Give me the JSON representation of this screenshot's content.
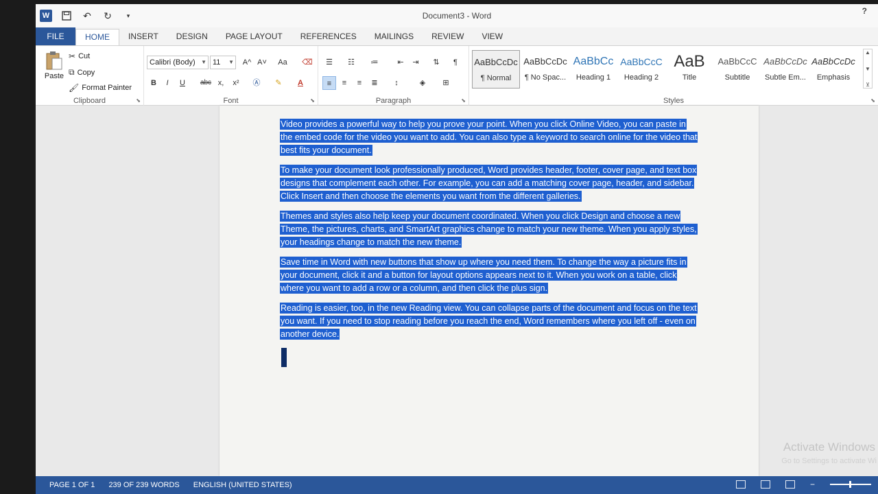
{
  "window": {
    "title": "Document3 - Word",
    "help": "?"
  },
  "tabs": [
    "FILE",
    "HOME",
    "INSERT",
    "DESIGN",
    "PAGE LAYOUT",
    "REFERENCES",
    "MAILINGS",
    "REVIEW",
    "VIEW"
  ],
  "clipboard": {
    "paste": "Paste",
    "cut": "Cut",
    "copy": "Copy",
    "format_painter": "Format Painter",
    "label": "Clipboard"
  },
  "font": {
    "family": "Calibri (Body)",
    "size": "11",
    "label": "Font",
    "bold": "B",
    "italic": "I",
    "underline": "U",
    "strike": "abc",
    "subscript": "x,",
    "superscript": "x²",
    "grow": "A^",
    "shrink": "A˅",
    "change_case": "Aa"
  },
  "paragraph": {
    "label": "Paragraph"
  },
  "styles": {
    "label": "Styles",
    "items": [
      {
        "sample": "AaBbCcDc",
        "name": "¶ Normal"
      },
      {
        "sample": "AaBbCcDc",
        "name": "¶ No Spac..."
      },
      {
        "sample": "AaBbCc",
        "name": "Heading 1"
      },
      {
        "sample": "AaBbCcC",
        "name": "Heading 2"
      },
      {
        "sample": "AaB",
        "name": "Title"
      },
      {
        "sample": "AaBbCcC",
        "name": "Subtitle"
      },
      {
        "sample": "AaBbCcDc",
        "name": "Subtle Em..."
      },
      {
        "sample": "AaBbCcDc",
        "name": "Emphasis"
      }
    ]
  },
  "document": {
    "paragraphs": [
      "Video provides a powerful way to help you prove your point. When you click Online Video, you can paste in the embed code for the video you want to add. You can also type a keyword to search online for the video that best fits your document.",
      "To make your document look professionally produced, Word provides header, footer, cover page, and text box designs that complement each other. For example, you can add a matching cover page, header, and sidebar. Click Insert and then choose the elements you want from the different galleries.",
      "Themes and styles also help keep your document coordinated. When you click Design and choose a new Theme, the pictures, charts, and SmartArt graphics change to match your new theme. When you apply styles, your headings change to match the new theme.",
      "Save time in Word with new buttons that show up where you need them. To change the way a picture fits in your document, click it and a button for layout options appears next to it. When you work on a table, click where you want to add a row or a column, and then click the plus sign.",
      "Reading is easier, too, in the new Reading view. You can collapse parts of the document and focus on the text you want. If you need to stop reading before you reach the end, Word remembers where you left off - even on another device."
    ]
  },
  "watermark": {
    "line1": "Activate Windows",
    "line2": "Go to Settings to activate Wi"
  },
  "status": {
    "page": "PAGE 1 OF 1",
    "words": "239 OF 239 WORDS",
    "language": "ENGLISH (UNITED STATES)"
  },
  "colors": {
    "accent": "#2b579a",
    "selection": "#1e5fd0"
  }
}
